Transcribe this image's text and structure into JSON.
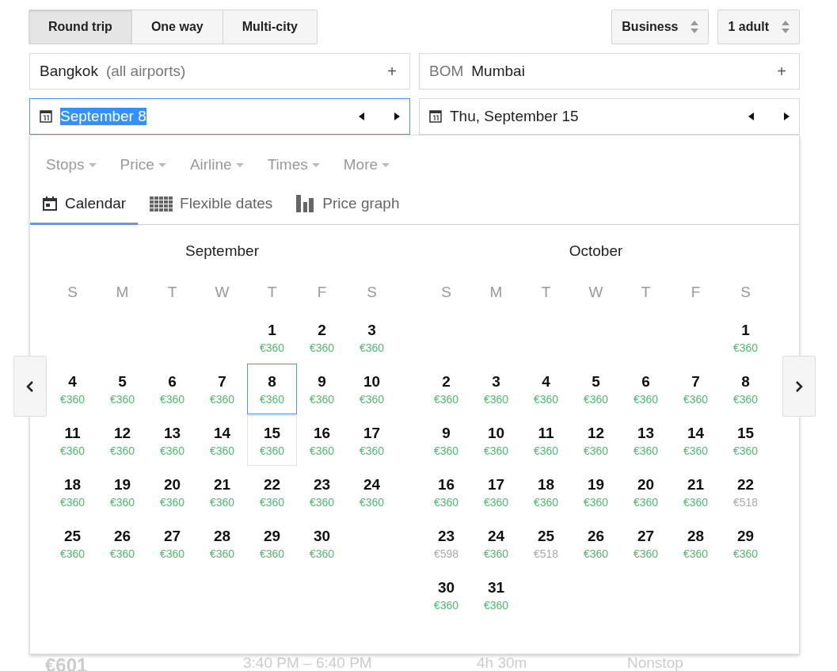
{
  "trip_types": [
    {
      "label": "Round trip",
      "selected": true
    },
    {
      "label": "One way",
      "selected": false
    },
    {
      "label": "Multi-city",
      "selected": false
    }
  ],
  "cabin": {
    "value": "Business"
  },
  "passengers": {
    "value": "1 adult"
  },
  "origin": {
    "parts": [
      {
        "text": "Bangkok",
        "muted": false
      },
      {
        "text": "(all airports)",
        "muted": true
      }
    ],
    "add": "+"
  },
  "destination": {
    "parts": [
      {
        "text": "BOM",
        "muted": true
      },
      {
        "text": "Mumbai",
        "muted": false
      }
    ],
    "add": "+"
  },
  "depart_date": {
    "value": "September 8",
    "focused": true,
    "text_selected": true
  },
  "return_date": {
    "value": "Thu, September 15",
    "focused": false,
    "text_selected": false
  },
  "filters": [
    "Stops",
    "Price",
    "Airline",
    "Times",
    "More"
  ],
  "view_tabs": [
    {
      "kind": "calendar",
      "label": "Calendar",
      "selected": true
    },
    {
      "kind": "grid",
      "label": "Flexible dates",
      "selected": false
    },
    {
      "kind": "graph",
      "label": "Price graph",
      "selected": false
    }
  ],
  "months": [
    {
      "name": "September",
      "weekdays": [
        "S",
        "M",
        "T",
        "W",
        "T",
        "F",
        "S"
      ],
      "weeks": [
        [
          {
            "day": "1",
            "price": "€360",
            "low_price": true,
            "selected": false,
            "return": false
          },
          {
            "day": "2",
            "price": "€360",
            "low_price": true,
            "selected": false,
            "return": false
          },
          {
            "day": "3",
            "price": "€360",
            "low_price": true,
            "selected": false,
            "return": false
          }
        ],
        [
          {
            "day": "4",
            "price": "€360",
            "low_price": true,
            "selected": false,
            "return": false
          },
          {
            "day": "5",
            "price": "€360",
            "low_price": true,
            "selected": false,
            "return": false
          },
          {
            "day": "6",
            "price": "€360",
            "low_price": true,
            "selected": false,
            "return": false
          },
          {
            "day": "7",
            "price": "€360",
            "low_price": true,
            "selected": false,
            "return": false
          },
          {
            "day": "8",
            "price": "€360",
            "low_price": true,
            "selected": true,
            "return": false
          },
          {
            "day": "9",
            "price": "€360",
            "low_price": true,
            "selected": false,
            "return": false
          },
          {
            "day": "10",
            "price": "€360",
            "low_price": true,
            "selected": false,
            "return": false
          }
        ],
        [
          {
            "day": "11",
            "price": "€360",
            "low_price": true,
            "selected": false,
            "return": false
          },
          {
            "day": "12",
            "price": "€360",
            "low_price": true,
            "selected": false,
            "return": false
          },
          {
            "day": "13",
            "price": "€360",
            "low_price": true,
            "selected": false,
            "return": false
          },
          {
            "day": "14",
            "price": "€360",
            "low_price": true,
            "selected": false,
            "return": false
          },
          {
            "day": "15",
            "price": "€360",
            "low_price": true,
            "selected": false,
            "return": true
          },
          {
            "day": "16",
            "price": "€360",
            "low_price": true,
            "selected": false,
            "return": false
          },
          {
            "day": "17",
            "price": "€360",
            "low_price": true,
            "selected": false,
            "return": false
          }
        ],
        [
          {
            "day": "18",
            "price": "€360",
            "low_price": true,
            "selected": false,
            "return": false
          },
          {
            "day": "19",
            "price": "€360",
            "low_price": true,
            "selected": false,
            "return": false
          },
          {
            "day": "20",
            "price": "€360",
            "low_price": true,
            "selected": false,
            "return": false
          },
          {
            "day": "21",
            "price": "€360",
            "low_price": true,
            "selected": false,
            "return": false
          },
          {
            "day": "22",
            "price": "€360",
            "low_price": true,
            "selected": false,
            "return": false
          },
          {
            "day": "23",
            "price": "€360",
            "low_price": true,
            "selected": false,
            "return": false
          },
          {
            "day": "24",
            "price": "€360",
            "low_price": true,
            "selected": false,
            "return": false
          }
        ],
        [
          {
            "day": "25",
            "price": "€360",
            "low_price": true,
            "selected": false,
            "return": false
          },
          {
            "day": "26",
            "price": "€360",
            "low_price": true,
            "selected": false,
            "return": false
          },
          {
            "day": "27",
            "price": "€360",
            "low_price": true,
            "selected": false,
            "return": false
          },
          {
            "day": "28",
            "price": "€360",
            "low_price": true,
            "selected": false,
            "return": false
          },
          {
            "day": "29",
            "price": "€360",
            "low_price": true,
            "selected": false,
            "return": false
          },
          {
            "day": "30",
            "price": "€360",
            "low_price": true,
            "selected": false,
            "return": false
          }
        ]
      ]
    },
    {
      "name": "October",
      "weekdays": [
        "S",
        "M",
        "T",
        "W",
        "T",
        "F",
        "S"
      ],
      "weeks": [
        [
          {
            "day": "1",
            "price": "€360",
            "low_price": true,
            "selected": false,
            "return": false
          }
        ],
        [
          {
            "day": "2",
            "price": "€360",
            "low_price": true,
            "selected": false,
            "return": false
          },
          {
            "day": "3",
            "price": "€360",
            "low_price": true,
            "selected": false,
            "return": false
          },
          {
            "day": "4",
            "price": "€360",
            "low_price": true,
            "selected": false,
            "return": false
          },
          {
            "day": "5",
            "price": "€360",
            "low_price": true,
            "selected": false,
            "return": false
          },
          {
            "day": "6",
            "price": "€360",
            "low_price": true,
            "selected": false,
            "return": false
          },
          {
            "day": "7",
            "price": "€360",
            "low_price": true,
            "selected": false,
            "return": false
          },
          {
            "day": "8",
            "price": "€360",
            "low_price": true,
            "selected": false,
            "return": false
          }
        ],
        [
          {
            "day": "9",
            "price": "€360",
            "low_price": true,
            "selected": false,
            "return": false
          },
          {
            "day": "10",
            "price": "€360",
            "low_price": true,
            "selected": false,
            "return": false
          },
          {
            "day": "11",
            "price": "€360",
            "low_price": true,
            "selected": false,
            "return": false
          },
          {
            "day": "12",
            "price": "€360",
            "low_price": true,
            "selected": false,
            "return": false
          },
          {
            "day": "13",
            "price": "€360",
            "low_price": true,
            "selected": false,
            "return": false
          },
          {
            "day": "14",
            "price": "€360",
            "low_price": true,
            "selected": false,
            "return": false
          },
          {
            "day": "15",
            "price": "€360",
            "low_price": true,
            "selected": false,
            "return": false
          }
        ],
        [
          {
            "day": "16",
            "price": "€360",
            "low_price": true,
            "selected": false,
            "return": false
          },
          {
            "day": "17",
            "price": "€360",
            "low_price": true,
            "selected": false,
            "return": false
          },
          {
            "day": "18",
            "price": "€360",
            "low_price": true,
            "selected": false,
            "return": false
          },
          {
            "day": "19",
            "price": "€360",
            "low_price": true,
            "selected": false,
            "return": false
          },
          {
            "day": "20",
            "price": "€360",
            "low_price": true,
            "selected": false,
            "return": false
          },
          {
            "day": "21",
            "price": "€360",
            "low_price": true,
            "selected": false,
            "return": false
          },
          {
            "day": "22",
            "price": "€518",
            "low_price": false,
            "selected": false,
            "return": false
          }
        ],
        [
          {
            "day": "23",
            "price": "€598",
            "low_price": false,
            "selected": false,
            "return": false
          },
          {
            "day": "24",
            "price": "€360",
            "low_price": true,
            "selected": false,
            "return": false
          },
          {
            "day": "25",
            "price": "€518",
            "low_price": false,
            "selected": false,
            "return": false
          },
          {
            "day": "26",
            "price": "€360",
            "low_price": true,
            "selected": false,
            "return": false
          },
          {
            "day": "27",
            "price": "€360",
            "low_price": true,
            "selected": false,
            "return": false
          },
          {
            "day": "28",
            "price": "€360",
            "low_price": true,
            "selected": false,
            "return": false
          },
          {
            "day": "29",
            "price": "€360",
            "low_price": true,
            "selected": false,
            "return": false
          }
        ],
        [
          {
            "day": "30",
            "price": "€360",
            "low_price": true,
            "selected": false,
            "return": false
          },
          {
            "day": "31",
            "price": "€360",
            "low_price": true,
            "selected": false,
            "return": false
          }
        ]
      ]
    }
  ],
  "result_peek": {
    "price": "€601",
    "times": "3:40 PM – 6:40 PM",
    "duration": "4h 30m",
    "stops": "Nonstop"
  }
}
